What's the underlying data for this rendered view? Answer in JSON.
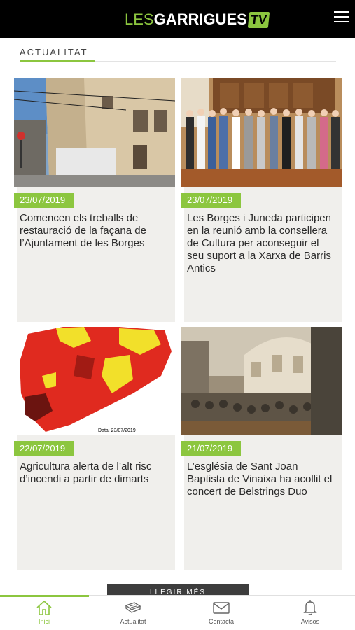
{
  "header": {
    "logo_les": "LES",
    "logo_garrigues": "GARRIGUES",
    "logo_tv": "TV",
    "menu_icon": "hamburger-menu-icon"
  },
  "section": {
    "title": "ACTUALITAT"
  },
  "articles": [
    {
      "date": "23/07/2019",
      "title": "Comencen els treballs de restauració de la façana de l’Ajuntament de les Borges",
      "image": "town-hall-facade-photo"
    },
    {
      "date": "23/07/2019",
      "title": "Les Borges i Juneda participen en la reunió amb la consellera de Cultura per aconseguir el seu suport a la Xarxa de Barris Antics",
      "image": "group-meeting-photo"
    },
    {
      "date": "22/07/2019",
      "title": "Agricultura alerta de l’alt risc d’incendi a partir de dimarts",
      "image": "fire-risk-map",
      "map_caption": "Data: 23/07/2019"
    },
    {
      "date": "21/07/2019",
      "title": "L’església de Sant Joan Baptista de Vinaixa ha acollit el concert de Belstrings Duo",
      "image": "church-concert-photo"
    }
  ],
  "more_button": "LLEGIR MÉS",
  "bottom_nav": [
    {
      "label": "Inici",
      "icon": "home-icon",
      "active": true
    },
    {
      "label": "Actualitat",
      "icon": "newspaper-icon",
      "active": false
    },
    {
      "label": "Contacta",
      "icon": "envelope-icon",
      "active": false
    },
    {
      "label": "Avisos",
      "icon": "bell-icon",
      "active": false
    }
  ],
  "colors": {
    "accent": "#8cc63f",
    "header_bg": "#000000",
    "card_bg": "#f0efec",
    "button_bg": "#3d3d3d"
  }
}
